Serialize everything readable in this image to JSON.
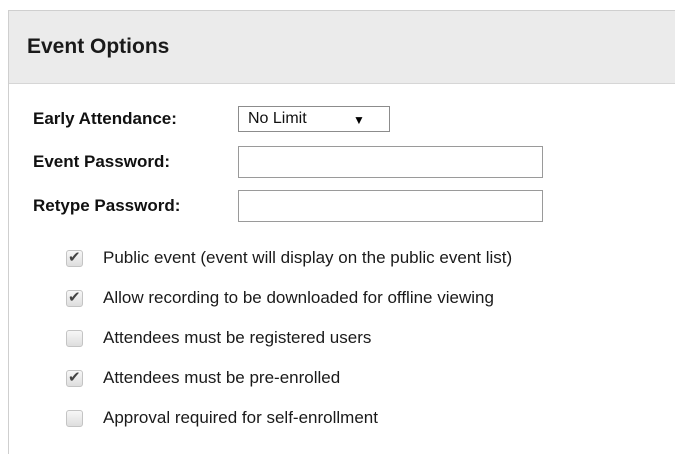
{
  "panel": {
    "title": "Event Options"
  },
  "fields": {
    "early_attendance": {
      "label": "Early Attendance:",
      "value": "No Limit",
      "arrow": "▼"
    },
    "password": {
      "label": "Event Password:",
      "value": ""
    },
    "retype_password": {
      "label": "Retype Password:",
      "value": ""
    }
  },
  "options": [
    {
      "label": "Public event (event will display on the public event list)",
      "checked": true
    },
    {
      "label": "Allow recording to be downloaded for offline viewing",
      "checked": true
    },
    {
      "label": "Attendees must be registered users",
      "checked": false
    },
    {
      "label": "Attendees must be pre-enrolled",
      "checked": true
    },
    {
      "label": "Approval required for self-enrollment",
      "checked": false
    }
  ],
  "icons": {
    "tick": "✔"
  }
}
